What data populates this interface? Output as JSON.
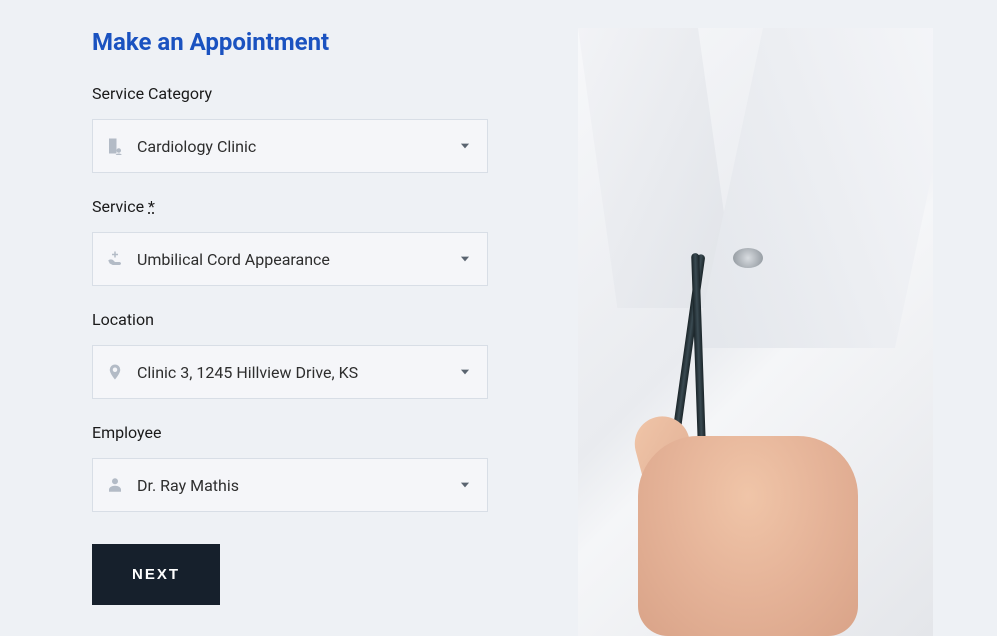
{
  "title": "Make an Appointment",
  "fields": {
    "category": {
      "label": "Service Category",
      "value": "Cardiology Clinic"
    },
    "service": {
      "label": "Service ",
      "required_mark": "*",
      "value": "Umbilical Cord Appearance"
    },
    "location": {
      "label": "Location",
      "value": "Clinic 3, 1245 Hillview Drive, KS"
    },
    "employee": {
      "label": "Employee",
      "value": "Dr. Ray Mathis"
    }
  },
  "button": {
    "next": "NEXT"
  }
}
